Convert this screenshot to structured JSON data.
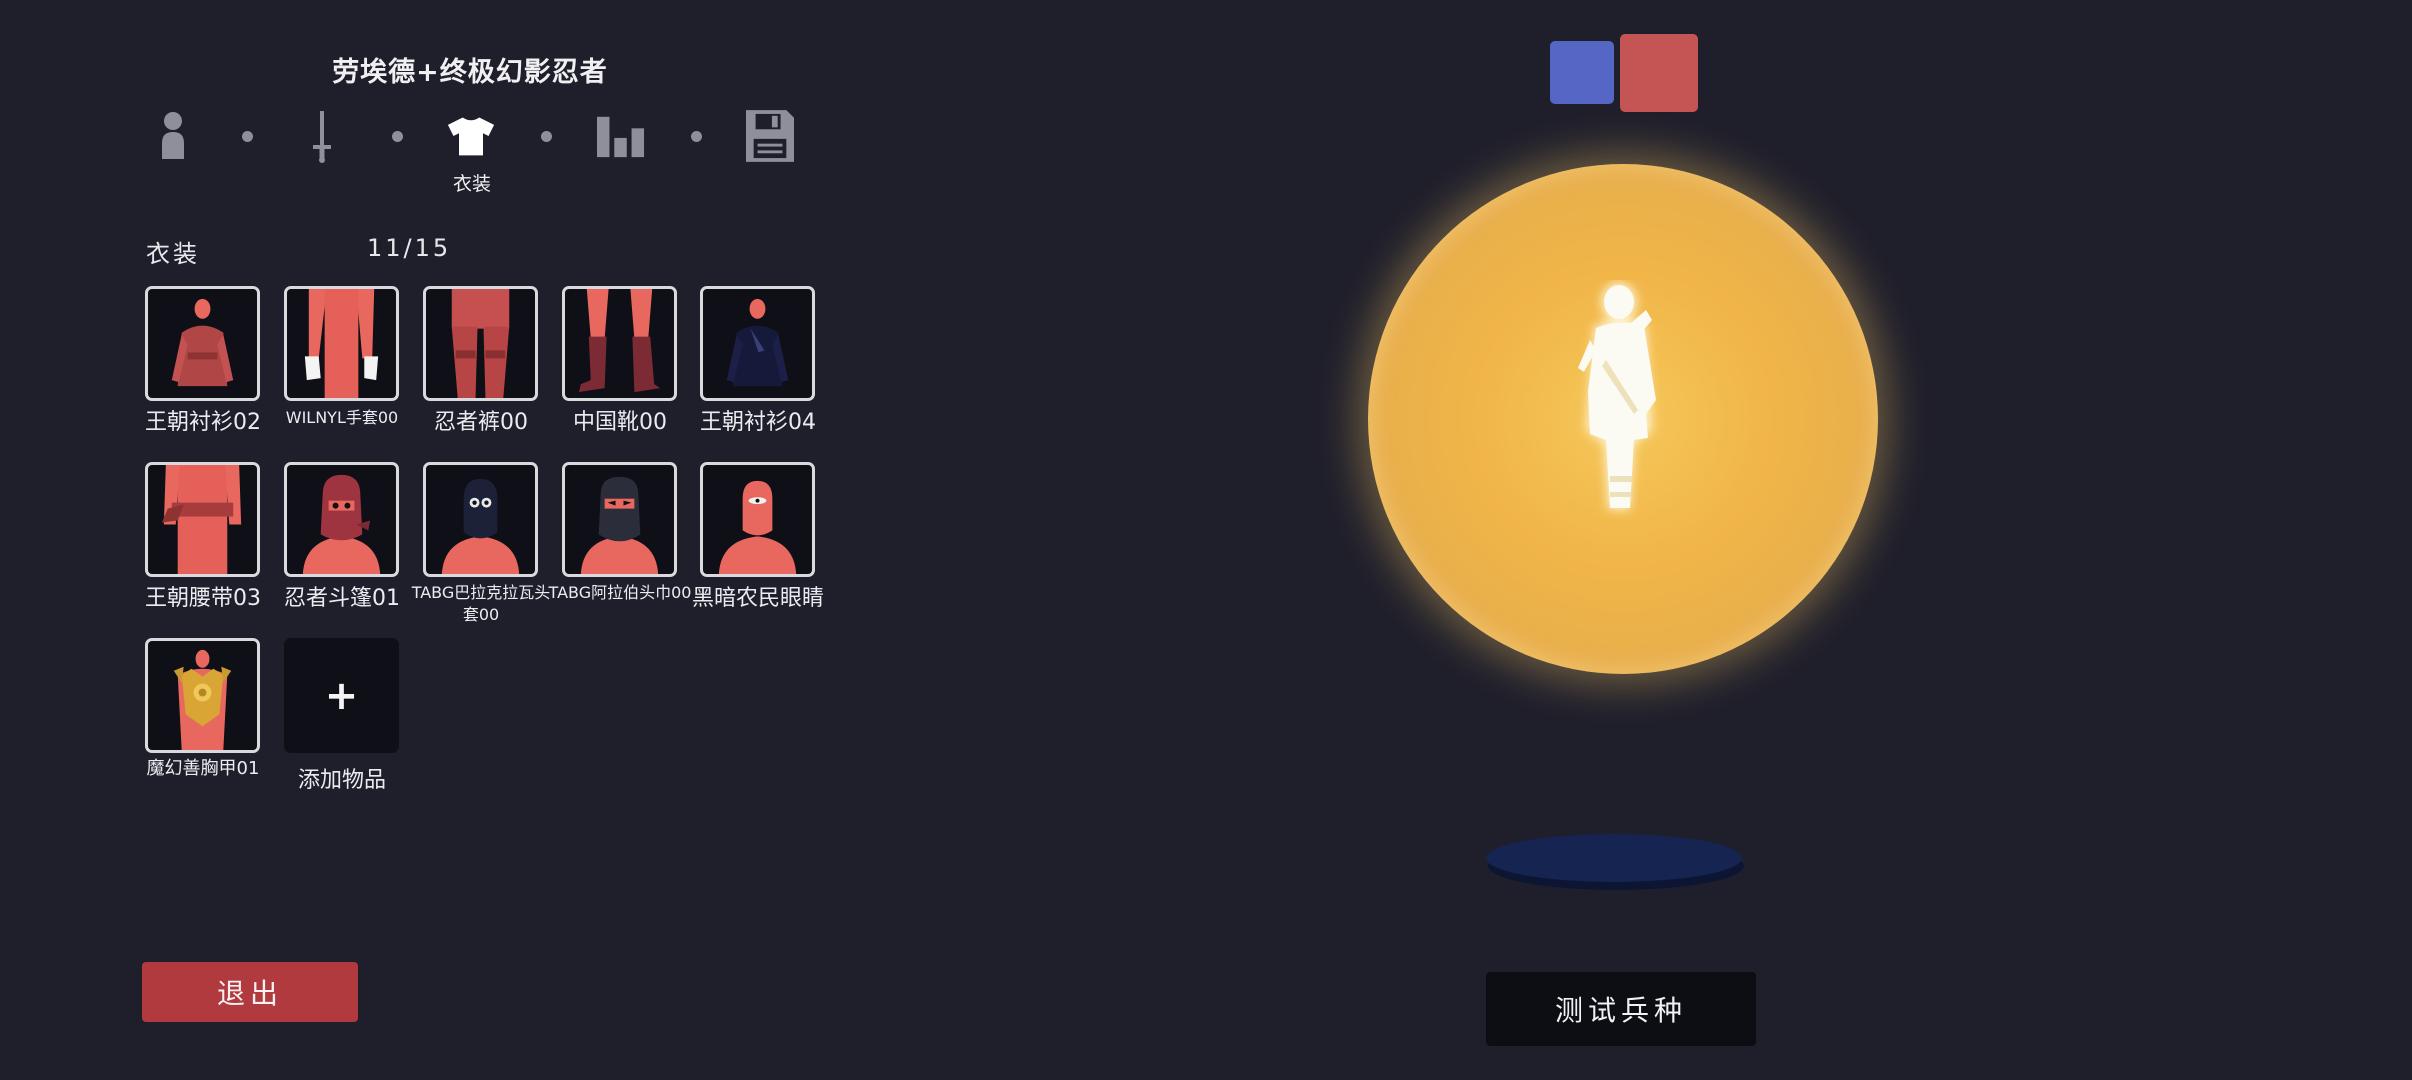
{
  "header": {
    "unit_name": "劳埃德+终极幻影忍者"
  },
  "steps": {
    "items": [
      {
        "name": "unit",
        "icon": "person-icon"
      },
      {
        "name": "weapons",
        "icon": "sword-icon"
      },
      {
        "name": "clothing",
        "icon": "shirt-icon"
      },
      {
        "name": "stats",
        "icon": "bar-chart-icon"
      },
      {
        "name": "save",
        "icon": "floppy-disk-icon"
      }
    ],
    "active_label": "衣装"
  },
  "section": {
    "title": "衣装",
    "count": "11/15"
  },
  "items": [
    {
      "label": "王朝衬衫02"
    },
    {
      "label": "WILNYL手套00"
    },
    {
      "label": "忍者裤00"
    },
    {
      "label": "中国靴00"
    },
    {
      "label": "王朝衬衫04"
    },
    {
      "label": "王朝腰带03"
    },
    {
      "label": "忍者斗篷01"
    },
    {
      "label": "TABG巴拉克拉瓦头套00"
    },
    {
      "label": "TABG阿拉伯头巾00"
    },
    {
      "label": "黑暗农民眼睛"
    },
    {
      "label": "魔幻善胸甲01"
    }
  ],
  "add_item": {
    "symbol": "+",
    "label": "添加物品"
  },
  "buttons": {
    "exit": "退出",
    "test_unit": "测试兵种"
  },
  "teams": {
    "blue_color": "#5566c4",
    "red_color": "#c55454"
  },
  "colors": {
    "tile_bg": "#0f1017",
    "figure": "#e8685f",
    "glow": "#f1b548",
    "exit_bg": "#b03a3e"
  }
}
